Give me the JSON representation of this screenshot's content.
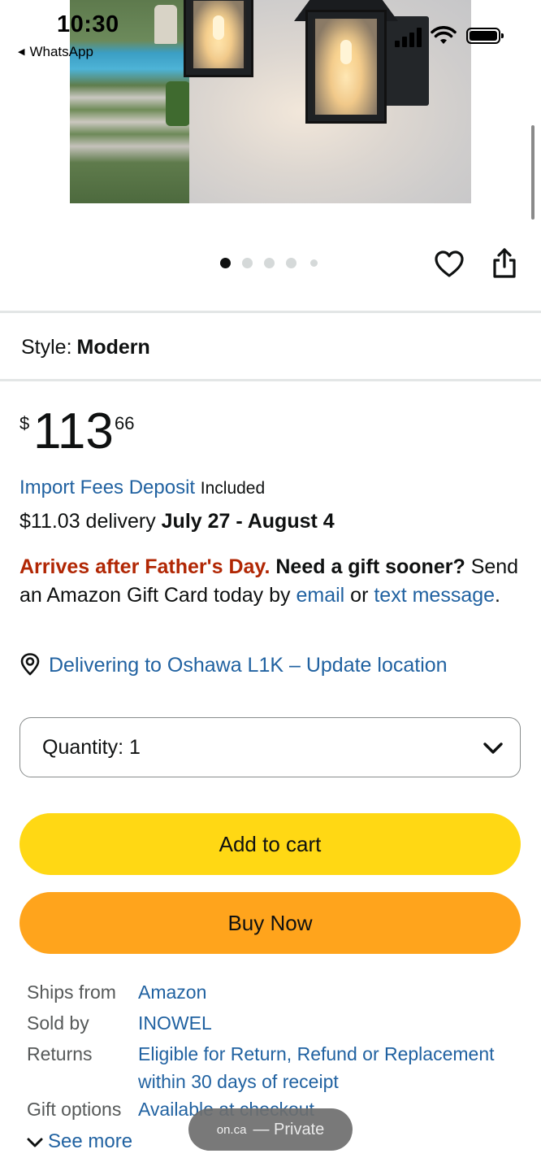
{
  "status_bar": {
    "time": "10:30",
    "back_app": "WhatsApp"
  },
  "product_image": {
    "description_icon": "product-photo",
    "carousel_dots": 5,
    "active_dot": 0
  },
  "style": {
    "label": "Style:",
    "value": "Modern"
  },
  "price": {
    "symbol": "$",
    "whole": "113",
    "fraction": "66"
  },
  "import_fees": {
    "link": "Import Fees Deposit",
    "status": "Included"
  },
  "delivery": {
    "cost": "$11.03 delivery",
    "dates": "July 27 - August 4"
  },
  "gift_notice": {
    "warning": "Arrives after Father's Day.",
    "question": "Need a gift sooner?",
    "text_before": "Send an Amazon Gift Card today by",
    "email_link": "email",
    "or": "or",
    "text_link": "text message",
    "end": "."
  },
  "location": {
    "text": "Delivering to Oshawa L1K – Update location"
  },
  "quantity": {
    "label": "Quantity:",
    "value": "1"
  },
  "buttons": {
    "add_to_cart": "Add to cart",
    "buy_now": "Buy Now"
  },
  "details": [
    {
      "key": "Ships from",
      "value": "Amazon"
    },
    {
      "key": "Sold by",
      "value": "INOWEL"
    },
    {
      "key": "Returns",
      "value": "Eligible for Return, Refund or Replacement within 30 days of receipt"
    },
    {
      "key": "Gift options",
      "value": "Available at checkout"
    }
  ],
  "see_more": "See more",
  "browser_pill": {
    "domain": "on.ca",
    "mode": "— Private"
  },
  "colors": {
    "link": "#2162a1",
    "warning": "#b12704",
    "add_to_cart": "#ffd814",
    "buy_now": "#ffa41c"
  }
}
